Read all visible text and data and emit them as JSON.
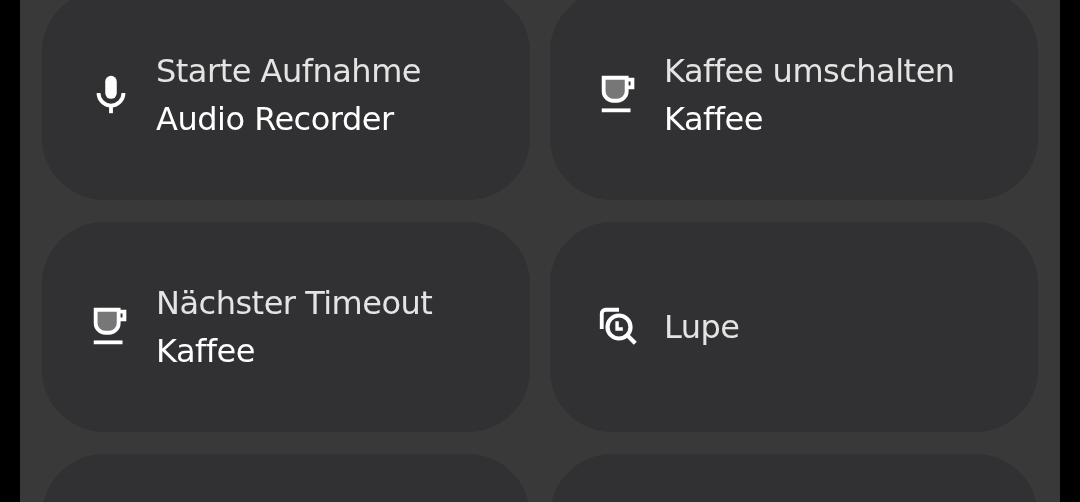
{
  "tiles": [
    {
      "kind": "microphone",
      "title": "Starte Aufnahme",
      "subtitle": "Audio Recorder"
    },
    {
      "kind": "cup",
      "title": "Kaffee umschalten",
      "subtitle": "Kaffee"
    },
    {
      "kind": "cup",
      "title": "Nächster Timeout",
      "subtitle": "Kaffee"
    },
    {
      "kind": "magnifier",
      "title": "Lupe"
    }
  ]
}
